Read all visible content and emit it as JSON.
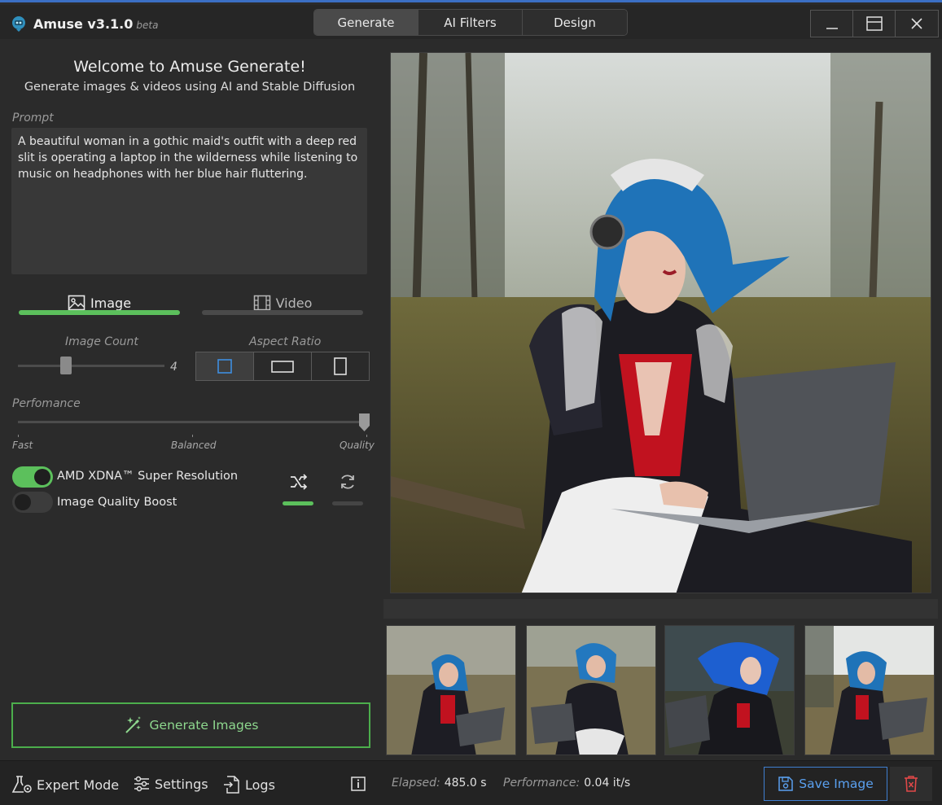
{
  "app": {
    "title": "Amuse v3.1.0",
    "beta": "beta"
  },
  "tabs": [
    {
      "label": "Generate",
      "active": true
    },
    {
      "label": "AI Filters",
      "active": false
    },
    {
      "label": "Design",
      "active": false
    }
  ],
  "welcome": {
    "title": "Welcome to Amuse Generate!",
    "subtitle": "Generate images & videos using AI and Stable Diffusion"
  },
  "prompt": {
    "label": "Prompt",
    "value": "A beautiful woman in a gothic maid's outfit with a deep red slit is operating a laptop in the wilderness while listening to music on headphones with her blue hair fluttering."
  },
  "mode": {
    "image_label": "Image",
    "video_label": "Video",
    "selected": "Image"
  },
  "image_count": {
    "label": "Image Count",
    "value": "4"
  },
  "aspect_ratio": {
    "label": "Aspect Ratio",
    "options": [
      "square",
      "landscape",
      "portrait"
    ],
    "selected": "square"
  },
  "performance": {
    "label": "Perfomance",
    "ticks": [
      "Fast",
      "Balanced",
      "Quality"
    ],
    "value": "Quality"
  },
  "toggles": [
    {
      "label": "AMD XDNA™ Super Resolution",
      "on": true
    },
    {
      "label": "Image Quality Boost",
      "on": false
    }
  ],
  "seed_buttons": [
    {
      "icon": "shuffle-icon",
      "active": true
    },
    {
      "icon": "refresh-icon",
      "active": false
    }
  ],
  "generate_button": "Generate Images",
  "bottom": {
    "expert_mode": "Expert Mode",
    "settings": "Settings",
    "logs": "Logs",
    "elapsed_label": "Elapsed:",
    "elapsed_value": "485.0 s",
    "performance_label": "Performance:",
    "performance_value": "0.04 it/s",
    "save_image": "Save Image"
  },
  "colors": {
    "accent_green": "#5cc05c",
    "accent_blue": "#3f7fd0",
    "danger_red": "#e04848"
  }
}
